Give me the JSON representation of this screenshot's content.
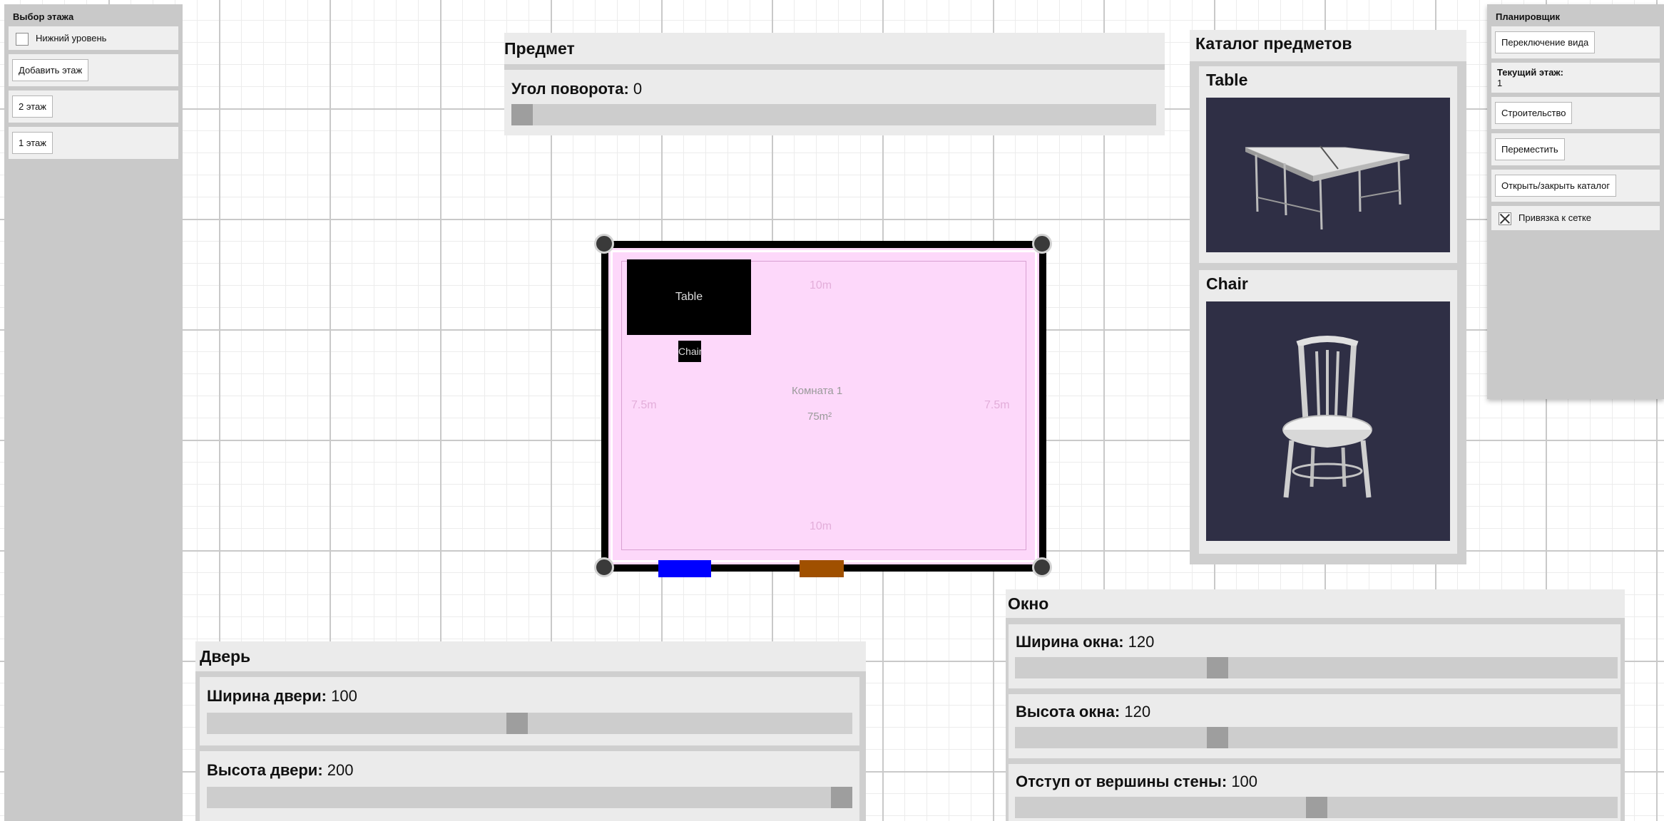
{
  "floor_panel": {
    "title": "Выбор этажа",
    "lower_level": {
      "label": "Нижний уровень",
      "checked": false
    },
    "add_floor": "Добавить этаж",
    "floors": [
      "2 этаж",
      "1 этаж"
    ]
  },
  "planner_panel": {
    "title": "Планировщик",
    "toggle_view": "Переключение вида",
    "current_floor_label": "Текущий этаж:",
    "current_floor_value": "1",
    "construction": "Строительство",
    "move": "Переместить",
    "toggle_catalog": "Открыть/закрыть каталог",
    "grid_snap": {
      "label": "Привязка к сетке",
      "checked": true
    }
  },
  "item_panel": {
    "title": "Предмет",
    "rotation_label": "Угол поворота:",
    "rotation_value": "0",
    "rotation_fraction": 0.0
  },
  "catalog": {
    "title": "Каталог предметов",
    "items": [
      {
        "name": "Table",
        "icon": "table-3d-preview"
      },
      {
        "name": "Chair",
        "icon": "chair-3d-preview"
      }
    ],
    "preview_bg": "#2f2f45"
  },
  "plan": {
    "room_name": "Комната 1",
    "room_area": "75m²",
    "dim_top": "10m",
    "dim_bottom": "10m",
    "dim_left": "7.5m",
    "dim_right": "7.5m",
    "furniture": [
      {
        "label": "Table"
      },
      {
        "label": "Chair"
      }
    ],
    "room_fill": "#fdd8fa",
    "door_color": "#a05000",
    "window_color": "#0000ff"
  },
  "door_panel": {
    "title": "Дверь",
    "width_label": "Ширина двери:",
    "width_value": "100",
    "width_fraction": 0.48,
    "height_label": "Высота двери:",
    "height_value": "200",
    "height_fraction": 1.0
  },
  "window_panel": {
    "title": "Окно",
    "width_label": "Ширина окна:",
    "width_value": "120",
    "width_fraction": 0.33,
    "height_label": "Высота окна:",
    "height_value": "120",
    "height_fraction": 0.33,
    "offset_label": "Отступ от вершины стены:",
    "offset_value": "100",
    "offset_fraction": 0.5
  }
}
